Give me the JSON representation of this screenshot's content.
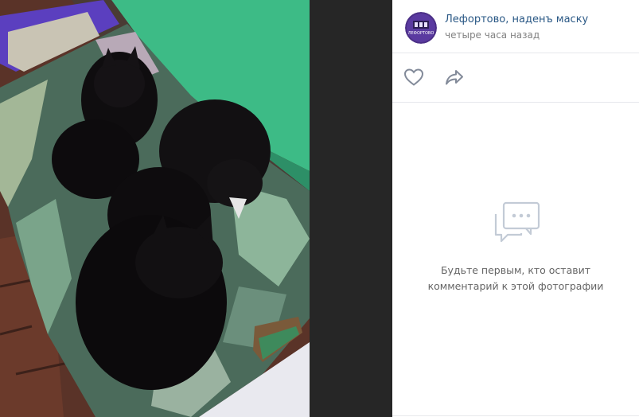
{
  "post": {
    "author": "Лефортово, наденъ маску",
    "time": "четыре часа назад",
    "avatar_text": "ЛЕФОРТОВО"
  },
  "actions": {
    "like_icon": "heart-outline-icon",
    "share_icon": "share-arrow-icon"
  },
  "comments": {
    "empty_line1": "Будьте первым, кто оставит",
    "empty_line2": "комментарий к этой фотографии",
    "empty_icon": "comments-icon"
  },
  "colors": {
    "link": "#2a5885",
    "muted": "#828282",
    "icon": "#828a99",
    "empty_icon": "#c3cbd6",
    "photo_bg": "#262626"
  }
}
